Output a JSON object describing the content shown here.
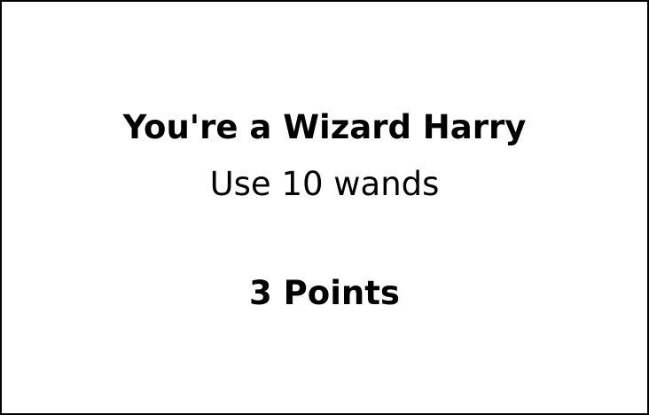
{
  "card": {
    "title": "You're a Wizard Harry",
    "subtitle": "Use 10 wands",
    "points": "3 Points",
    "border_color": "#000000",
    "background_color": "#ffffff"
  }
}
